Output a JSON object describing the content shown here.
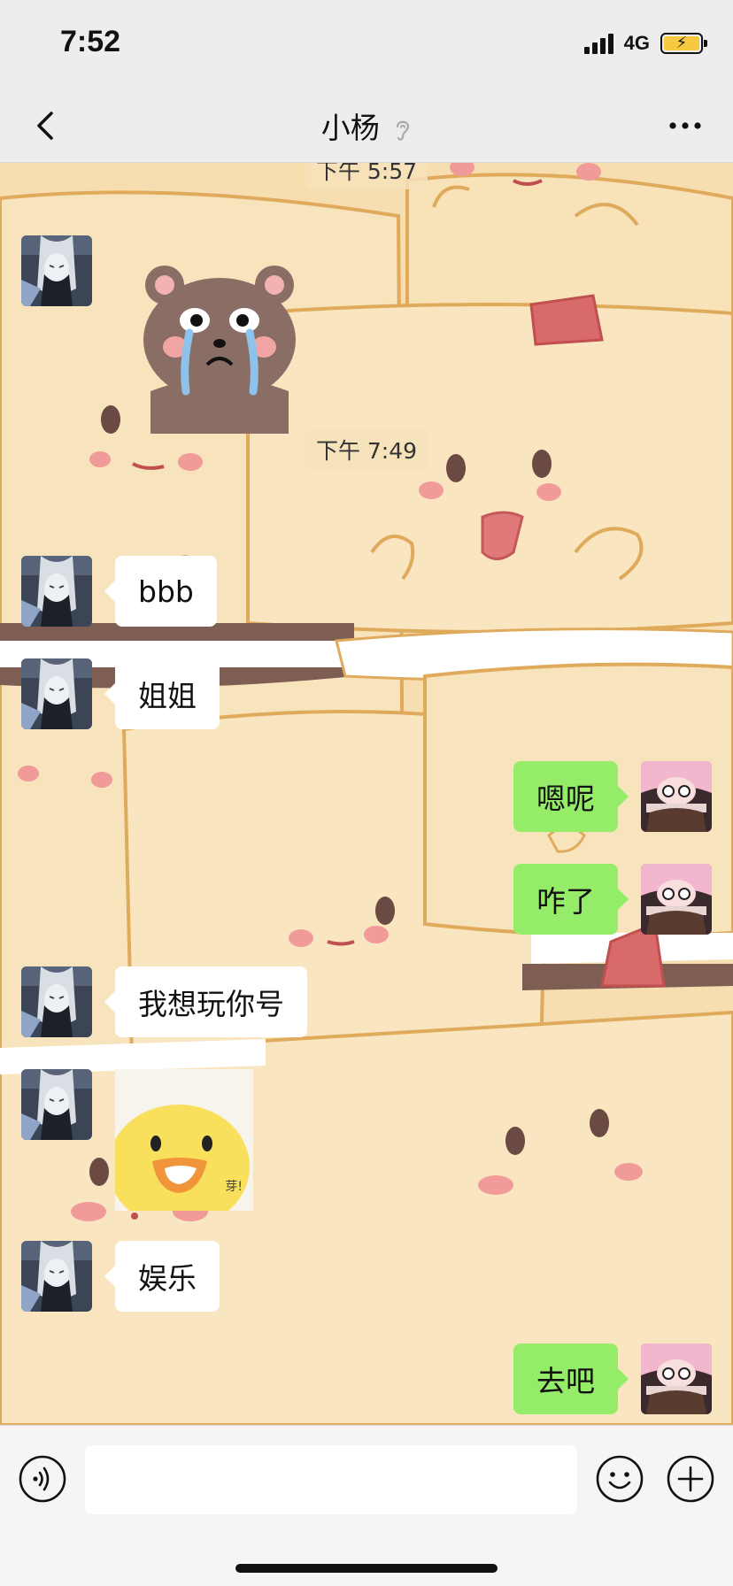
{
  "status_bar": {
    "time": "7:52",
    "network": "4G",
    "battery_color": "#f7c940"
  },
  "nav": {
    "title": "小杨",
    "back_icon": "chevron-left-icon",
    "title_icon": "ear-icon",
    "more_icon": "more-dots-icon"
  },
  "chat": {
    "wallpaper": "cute-toast-characters-pattern",
    "timestamps": [
      "下午 5:57",
      "下午 7:49"
    ],
    "messages": [
      {
        "side": "in",
        "type": "sticker",
        "sticker": "crying-bear-sticker"
      },
      {
        "side": "in",
        "type": "text",
        "text": "bbb"
      },
      {
        "side": "in",
        "type": "text",
        "text": "姐姐"
      },
      {
        "side": "out",
        "type": "text",
        "text": "嗯呢"
      },
      {
        "side": "out",
        "type": "text",
        "text": "咋了"
      },
      {
        "side": "in",
        "type": "text",
        "text": "我想玩你号"
      },
      {
        "side": "in",
        "type": "sticker",
        "sticker": "yellow-chick-sticker",
        "sticker_text": "芽!"
      },
      {
        "side": "in",
        "type": "text",
        "text": "娱乐"
      },
      {
        "side": "out",
        "type": "text",
        "text": "去吧"
      }
    ],
    "incoming_bubble_color": "#ffffff",
    "outgoing_bubble_color": "#95ec69"
  },
  "input_bar": {
    "voice_icon": "voice-icon",
    "emoji_icon": "emoji-icon",
    "plus_icon": "plus-icon",
    "placeholder": ""
  }
}
